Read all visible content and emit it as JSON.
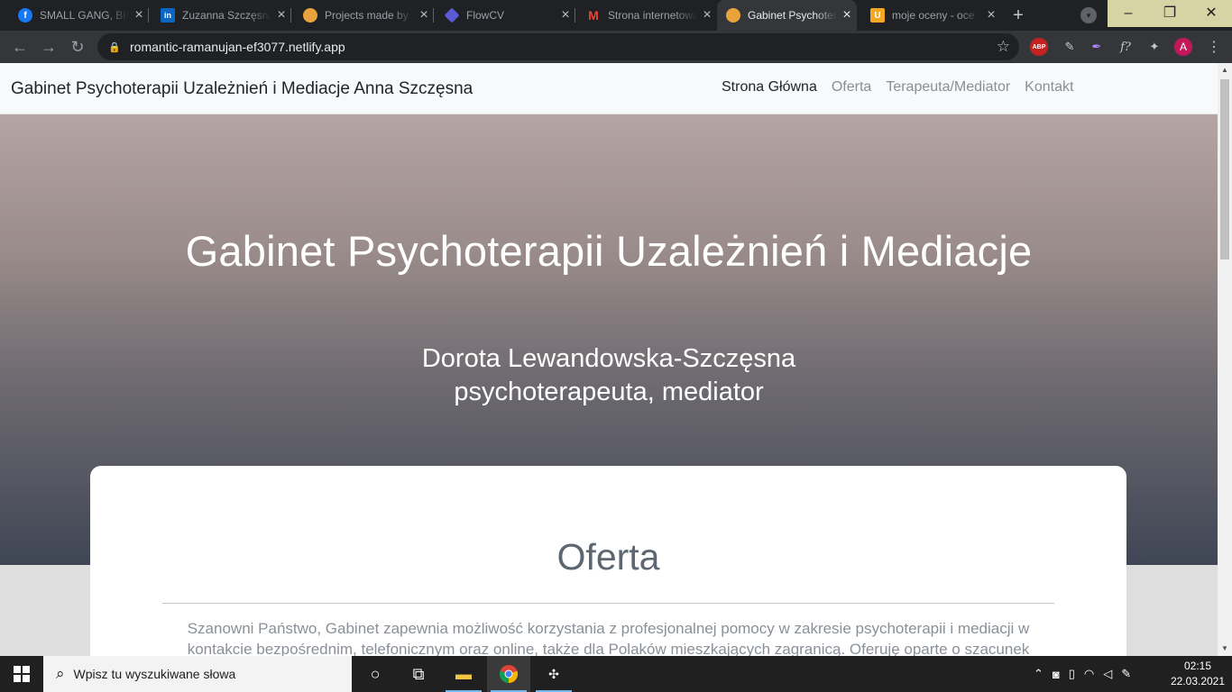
{
  "browser": {
    "tabs": [
      {
        "title": "SMALL GANG, BIG",
        "icon": "facebook-icon",
        "color": "#1877f2",
        "glyph": "f"
      },
      {
        "title": "Zuzanna Szczęsna",
        "icon": "linkedin-icon",
        "color": "#0a66c2",
        "glyph": "in"
      },
      {
        "title": "Projects made by",
        "icon": "globe-icon",
        "color": "#e8a33d",
        "glyph": ""
      },
      {
        "title": "FlowCV",
        "icon": "flowcv-icon",
        "color": "#5b5bd6",
        "glyph": ""
      },
      {
        "title": "Strona internetowa",
        "icon": "gmail-icon",
        "color": "#ea4335",
        "glyph": "M"
      },
      {
        "title": "Gabinet Psychoterapii",
        "icon": "globe-icon",
        "color": "#e8a33d",
        "glyph": ""
      },
      {
        "title": "moje oceny - oce",
        "icon": "u-logo-icon",
        "color": "#f5a623",
        "glyph": "U"
      }
    ],
    "new_tab_label": "+",
    "url": "romantic-ramanujan-ef3077.netlify.app",
    "profile_initial": "A",
    "abp_label": "ABP"
  },
  "site": {
    "brand": "Gabinet Psychoterapii Uzależnień i Mediacje Anna Szczęsna",
    "nav": [
      "Strona Główna",
      "Oferta",
      "Terapeuta/Mediator",
      "Kontakt"
    ],
    "hero_title": "Gabinet Psychoterapii Uzależnień i Mediacje",
    "hero_name": "Dorota Lewandowska-Szczęsna",
    "hero_role": "psychoterapeuta, mediator",
    "section_title": "Oferta",
    "section_text": "Szanowni Państwo, Gabinet zapewnia możliwość korzystania z profesjonalnej pomocy w zakresie psychoterapii i mediacji w kontakcie bezpośrednim, telefonicznym oraz online, także dla Polaków mieszkających zagranicą. Oferuję oparte o szacunek"
  },
  "taskbar": {
    "search_placeholder": "Wpisz tu wyszukiwane słowa",
    "time": "02:15",
    "date": "22.03.2021"
  }
}
